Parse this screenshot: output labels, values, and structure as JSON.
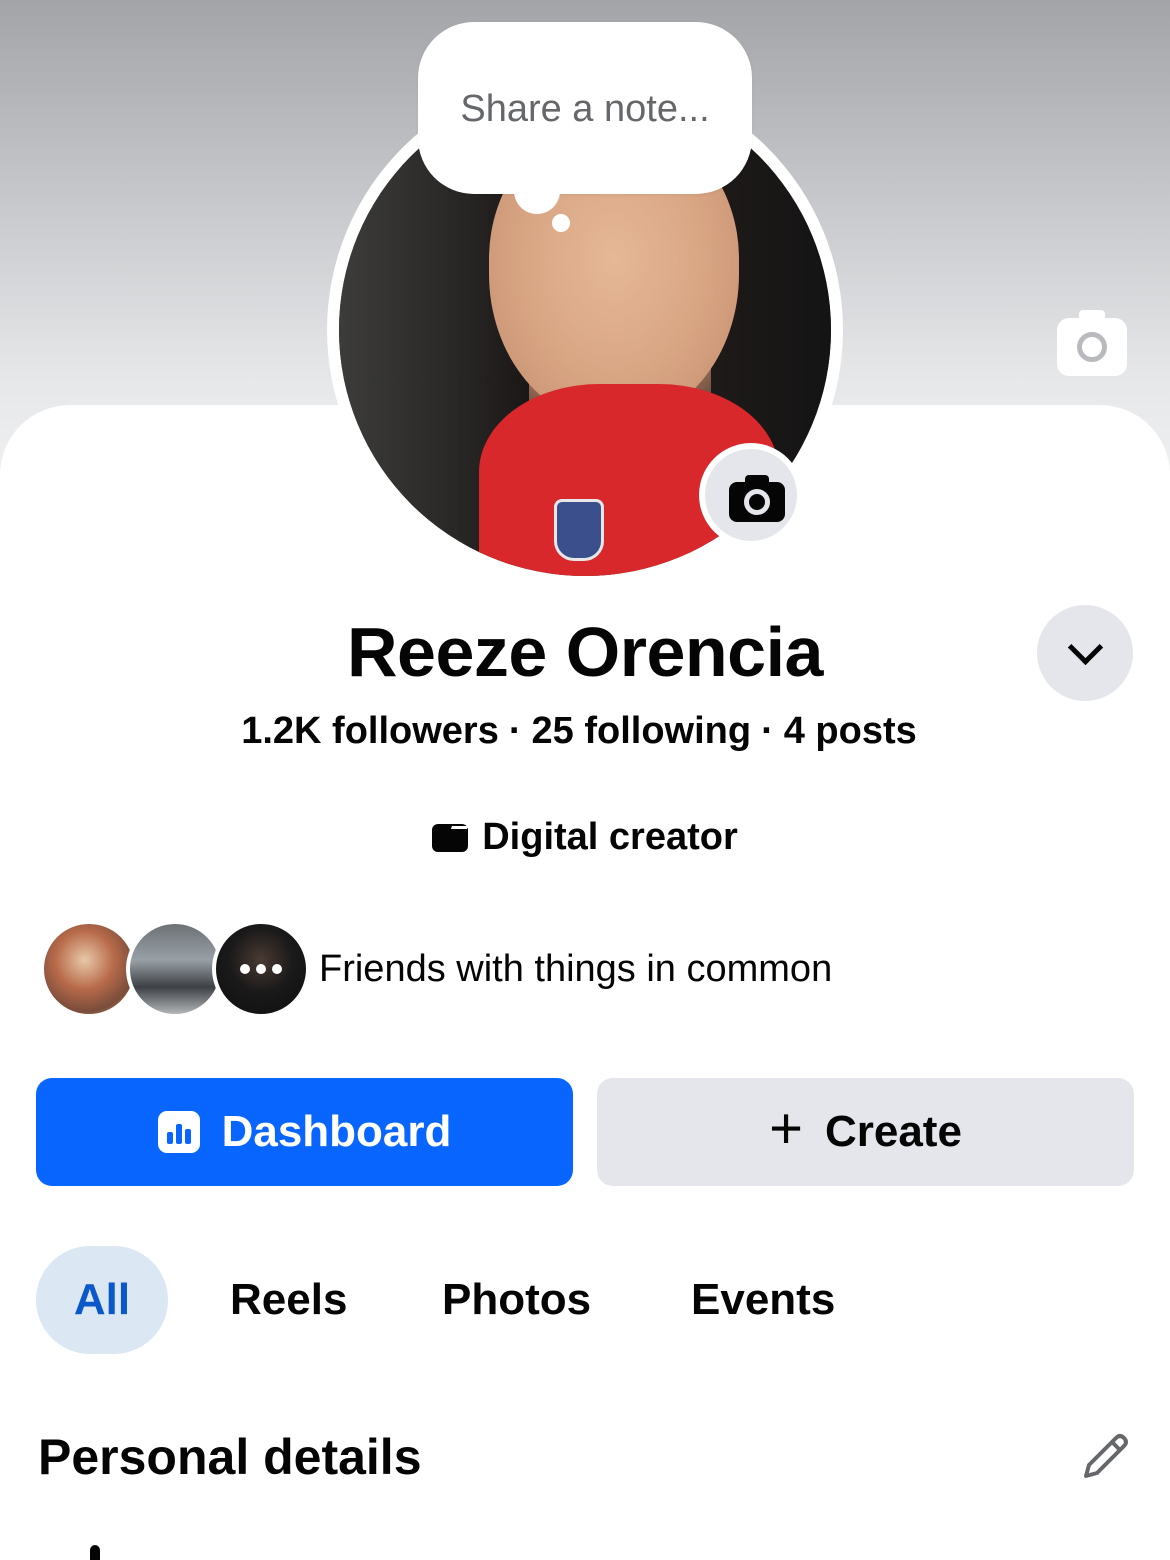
{
  "note": {
    "placeholder": "Share a note..."
  },
  "profile": {
    "name": "Reeze Orencia",
    "followers": "1.2K followers",
    "following": "25 following",
    "posts": "4 posts",
    "separator": "·",
    "category": "Digital creator"
  },
  "friends": {
    "text": "Friends with things in common"
  },
  "actions": {
    "dashboard_label": "Dashboard",
    "create_label": "Create",
    "create_icon": "+"
  },
  "tabs": [
    {
      "label": "All",
      "active": true
    },
    {
      "label": "Reels",
      "active": false
    },
    {
      "label": "Photos",
      "active": false
    },
    {
      "label": "Events",
      "active": false
    }
  ],
  "section": {
    "title": "Personal details"
  },
  "icons": {
    "cover_camera": "camera-icon",
    "avatar_camera": "camera-icon",
    "chevron": "chevron-down-icon",
    "category": "clapperboard-icon",
    "dashboard": "bar-chart-icon",
    "create": "plus-icon",
    "edit": "pencil-icon"
  },
  "colors": {
    "accent": "#0866ff",
    "active_tab_bg": "#dbe7f2",
    "active_tab_text": "#0a58ca",
    "secondary_bg": "#e4e6eb"
  }
}
